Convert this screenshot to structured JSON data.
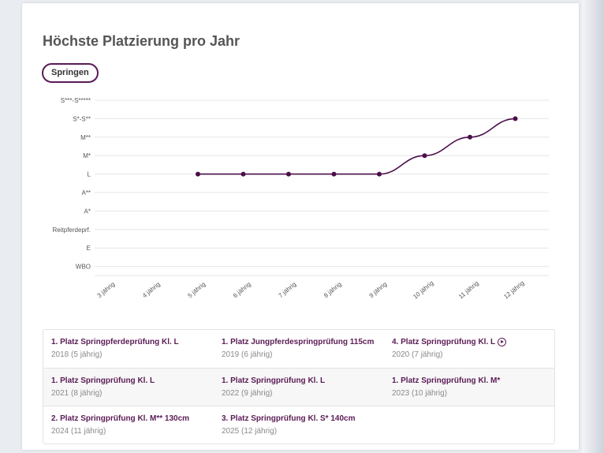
{
  "title": "Höchste Platzierung pro Jahr",
  "filter_label": "Springen",
  "chart_data": {
    "type": "line",
    "title": "Höchste Platzierung pro Jahr",
    "xlabel": "",
    "ylabel": "",
    "categories": [
      "3 jährig",
      "4 jährig",
      "5 jährig",
      "6 jährig",
      "7 jährig",
      "8 jährig",
      "9 jährig",
      "10 jährig",
      "11 jährig",
      "12 jährig"
    ],
    "levels": [
      "WBO",
      "E",
      "Reitpferdeprf.",
      "A*",
      "A**",
      "L",
      "M*",
      "M**",
      "S*-S**",
      "S***-S*****"
    ],
    "series": [
      {
        "values": [
          null,
          null,
          "L",
          "L",
          "L",
          "L",
          "L",
          "M*",
          "M**",
          "S*-S**"
        ]
      }
    ],
    "grid": true,
    "line_color": "#4b0e4a"
  },
  "results": [
    {
      "title": "1. Platz Springpferdeprüfung Kl. L",
      "sub": "2018 (5 jährig)"
    },
    {
      "title": "1. Platz Jungpferdespringprüfung 115cm",
      "sub": "2019 (6 jährig)"
    },
    {
      "title": "4. Platz Springprüfung Kl. L",
      "sub": "2020 (7 jährig)",
      "icon": "play-circle-icon"
    },
    {
      "title": "1. Platz Springprüfung Kl. L",
      "sub": "2021 (8 jährig)"
    },
    {
      "title": "1. Platz Springprüfung Kl. L",
      "sub": "2022 (9 jährig)"
    },
    {
      "title": "1. Platz Springprüfung Kl. M*",
      "sub": "2023 (10 jährig)"
    },
    {
      "title": "2. Platz Springprüfung Kl. M** 130cm",
      "sub": "2024 (11 jährig)"
    },
    {
      "title": "3. Platz Springprüfung Kl. S* 140cm",
      "sub": "2025 (12 jährig)"
    }
  ]
}
